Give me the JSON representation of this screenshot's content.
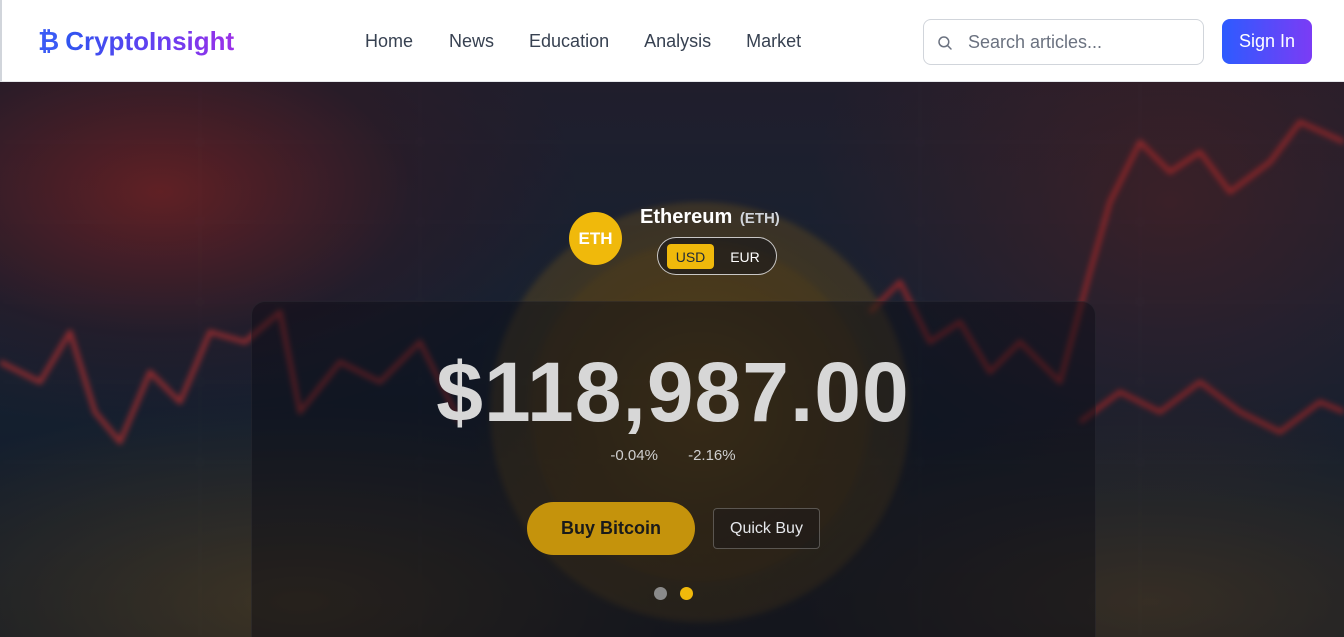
{
  "brand": {
    "icon": "bitcoin-icon",
    "icon_glyph": "₿",
    "name": "CryptoInsight",
    "gradient": [
      "#2f55f0",
      "#9b30e8"
    ]
  },
  "nav": [
    {
      "label": "Home"
    },
    {
      "label": "News"
    },
    {
      "label": "Education"
    },
    {
      "label": "Analysis"
    },
    {
      "label": "Market"
    }
  ],
  "search": {
    "placeholder": "Search articles...",
    "value": "",
    "icon": "search-icon"
  },
  "header": {
    "signin_label": "Sign In"
  },
  "hero": {
    "coin": {
      "badge": "ETH",
      "name": "Ethereum",
      "symbol": "(ETH)",
      "badge_color": "#f0b90b"
    },
    "currency": {
      "options": [
        "USD",
        "EUR"
      ],
      "selected": "USD"
    },
    "price": "$118,987.00",
    "change_1": "-0.04%",
    "change_2": "-2.16%",
    "buy_label": "Buy Bitcoin",
    "quick_buy_label": "Quick Buy",
    "carousel": {
      "slides": 2,
      "active": 2
    }
  }
}
